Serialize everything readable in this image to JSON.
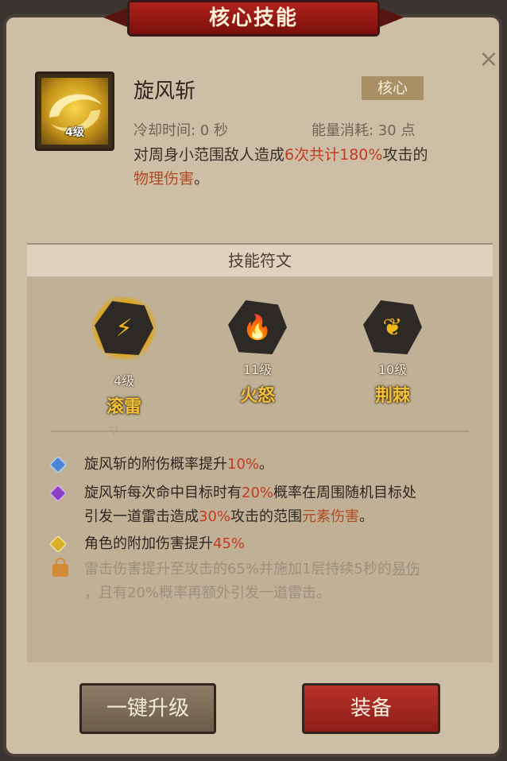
{
  "window": {
    "title": "核心技能"
  },
  "skill": {
    "name": "旋风斩",
    "level": "4级",
    "tag": "核心",
    "cooldown": "冷却时间: 0 秒",
    "energy": "能量消耗: 30 点",
    "desc": {
      "part1": "对周身小范围敌人造成",
      "hit_count": "6次共计180%",
      "part2": "攻击的",
      "damage_type": "物理伤害",
      "end": "。"
    }
  },
  "runes": {
    "header": "技能符文",
    "items": [
      {
        "level": "4级",
        "name": "滚雷",
        "icon": "lightning-rune-icon",
        "selected": true
      },
      {
        "level": "11级",
        "name": "火怒",
        "icon": "fire-rune-icon",
        "selected": false
      },
      {
        "level": "10级",
        "name": "荆棘",
        "icon": "thorn-rune-icon",
        "selected": false
      }
    ]
  },
  "effects": [
    {
      "icon": "blue-diamond-icon",
      "text_a": "旋风斩的附伤概率提升",
      "highlight": "10%",
      "text_b": "。"
    },
    {
      "icon": "purple-diamond-icon",
      "line1_a": "旋风斩每次命中目标时有",
      "line1_hl": "20%",
      "line1_b": "概率在周围随机目标处",
      "line2_a": "引发一道雷击造成",
      "line2_hl": "30%",
      "line2_b": "攻击的范围",
      "line2_hl2": "元素伤害",
      "line2_c": "。"
    },
    {
      "icon": "gold-diamond-icon",
      "text_a": "角色的附加伤害提升",
      "highlight": "45%"
    },
    {
      "icon": "lock-icon",
      "line1": "雷击伤害提升至攻击的65%并施加1层持续5秒的",
      "line1_u": "易伤",
      "line2": "，且有20%概率再额外引发一道雷击。"
    }
  ],
  "buttons": {
    "upgrade": "一键升级",
    "equip": "装备"
  },
  "close_glyph": "×",
  "colors": {
    "highlight_red": "#c43a22",
    "rune_gold": "#f3c23a",
    "equip_red": "#b7322a"
  }
}
